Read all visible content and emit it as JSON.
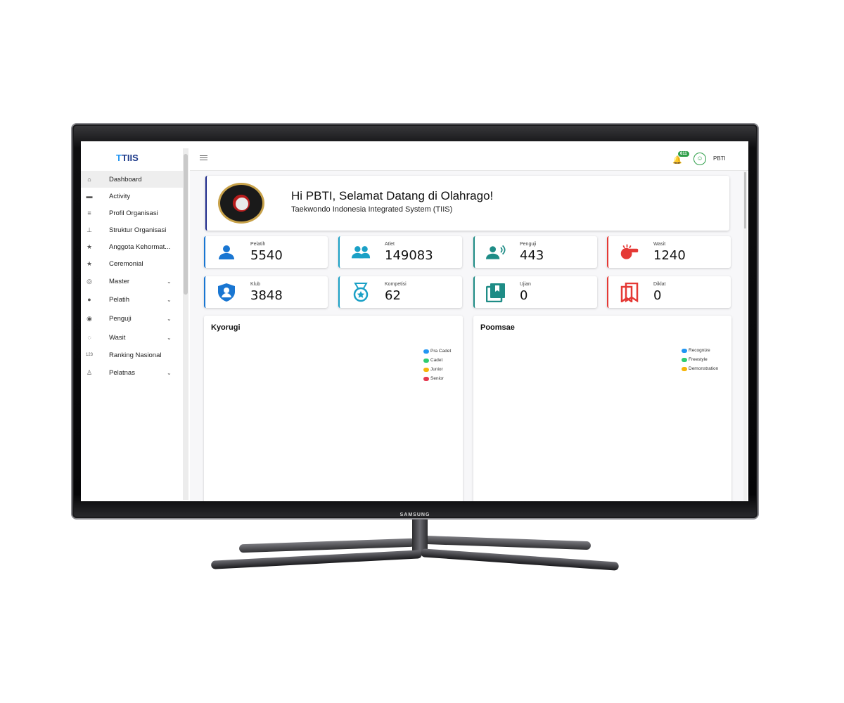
{
  "tv": {
    "brand": "SAMSUNG"
  },
  "sidebar": {
    "brand_prefix": "T",
    "brand_text": "TIIS",
    "items": [
      {
        "label": "Dashboard",
        "icon": "home-icon",
        "glyph": "⌂"
      },
      {
        "label": "Activity",
        "icon": "activity-icon",
        "glyph": "▬"
      },
      {
        "label": "Profil Organisasi",
        "icon": "profile-icon",
        "glyph": "≡"
      },
      {
        "label": "Struktur Organisasi",
        "icon": "structure-icon",
        "glyph": "⊥"
      },
      {
        "label": "Anggota Kehormat...",
        "icon": "star-icon",
        "glyph": "★"
      },
      {
        "label": "Ceremonial",
        "icon": "star-icon",
        "glyph": "★"
      },
      {
        "label": "Master",
        "icon": "database-icon",
        "glyph": "◎"
      },
      {
        "label": "Pelatih",
        "icon": "user-icon",
        "glyph": "●"
      },
      {
        "label": "Penguji",
        "icon": "examiner-icon",
        "glyph": "◉"
      },
      {
        "label": "Wasit",
        "icon": "whistle-icon",
        "glyph": "◌"
      },
      {
        "label": "Ranking Nasional",
        "icon": "ranking-icon",
        "glyph": "123"
      },
      {
        "label": "Pelatnas",
        "icon": "person-icon",
        "glyph": "♙"
      }
    ]
  },
  "topbar": {
    "notification_count": "611",
    "username": "PBTI"
  },
  "welcome": {
    "title": "Hi PBTI, Selamat Datang di Olahrago!",
    "subtitle": "Taekwondo Indonesia Integrated System (TIIS)"
  },
  "stats": [
    {
      "label": "Pelatih",
      "value": "5540"
    },
    {
      "label": "Atlet",
      "value": "149083"
    },
    {
      "label": "Penguji",
      "value": "443"
    },
    {
      "label": "Wasit",
      "value": "1240"
    },
    {
      "label": "Klub",
      "value": "3848"
    },
    {
      "label": "Kompetisi",
      "value": "62"
    },
    {
      "label": "Ujian",
      "value": "0"
    },
    {
      "label": "Diklat",
      "value": "0"
    }
  ],
  "panels": {
    "kyorugi": {
      "title": "Kyorugi",
      "legend": [
        {
          "label": "Pra Cadet",
          "color": "#2196f3"
        },
        {
          "label": "Cadet",
          "color": "#2ecc71"
        },
        {
          "label": "Junior",
          "color": "#f5b50a"
        },
        {
          "label": "Senior",
          "color": "#e53950"
        }
      ]
    },
    "poomsae": {
      "title": "Poomsae",
      "legend": [
        {
          "label": "Recognize",
          "color": "#2196f3"
        },
        {
          "label": "Freestyle",
          "color": "#2ecc71"
        },
        {
          "label": "Demonstration",
          "color": "#f5b50a"
        }
      ]
    }
  }
}
